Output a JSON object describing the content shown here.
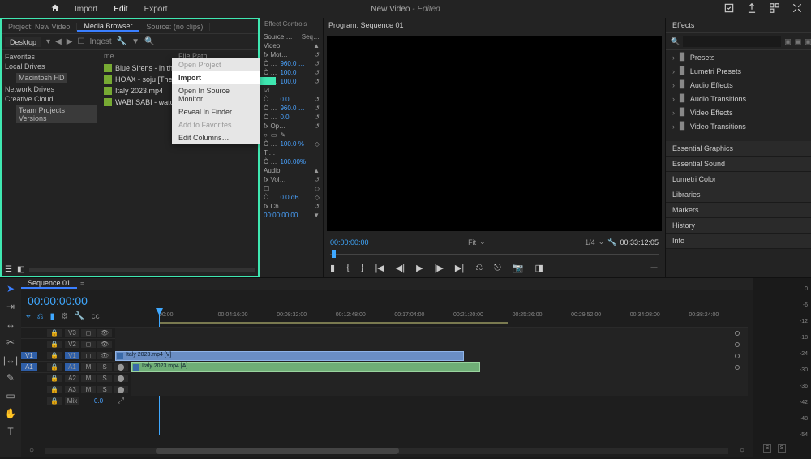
{
  "app_title": "New Video",
  "app_edited": "- Edited",
  "main_menu": {
    "import": "Import",
    "edit": "Edit",
    "export": "Export"
  },
  "project_panel": {
    "tabs": {
      "project": "Project: New Video",
      "media_browser": "Media Browser",
      "source": "Source: (no clips)"
    },
    "location_dropdown": "Desktop",
    "ingest_label": "Ingest",
    "tree": {
      "favorites": "Favorites",
      "local_drives": "Local Drives",
      "mac_hd": "Macintosh HD",
      "network_drives": "Network Drives",
      "creative_cloud": "Creative Cloud",
      "team_projects": "Team Projects Versions"
    },
    "list_headers": {
      "name": "me",
      "path": "File Path"
    },
    "files": [
      {
        "name": "Blue Sirens - in the win…"
      },
      {
        "name": "HOAX - soju [Thematic]"
      },
      {
        "name": "Italy 2023.mp4"
      },
      {
        "name": "WABI SABI - watch the …"
      }
    ]
  },
  "context_menu": {
    "open_project": "Open Project",
    "import": "Import",
    "open_source_monitor": "Open In Source Monitor",
    "reveal_finder": "Reveal In Finder",
    "add_favorites": "Add to Favorites",
    "edit_columns": "Edit Columns…"
  },
  "effect_controls": {
    "tab": "Effect Controls",
    "seq": "Seq…",
    "source_label": "Source …",
    "video": "Video",
    "motion": "fx  Mot…",
    "pos": "Ò  …",
    "pos_val": "960.0 …",
    "scale": "Ò  …",
    "scale_val": "100.0",
    "scalew": "Ò  …",
    "scalew_val": "100.0",
    "rot": "Ò  …",
    "rot_val": "0.0",
    "anchor": "Ò  …",
    "anchor_val": "960.0 …",
    "antiflicker": "Ò  …",
    "antiflicker_val": "0.0",
    "opacity": "fx  Op…",
    "op": "Ò  …",
    "op_val": "100.0  %",
    "time": "Ti…",
    "speed": "Ò  …",
    "speed_val": "100.00%",
    "audio": "Audio",
    "volume": "fx  Vol…",
    "level": "Ò  …",
    "level_val": "0.0  dB",
    "channel": "fx  Ch…",
    "tl_time": "00:00:00:00"
  },
  "program": {
    "tab": "Program: Sequence 01",
    "time": "00:00:00:00",
    "fit": "Fit",
    "scale": "1/4",
    "duration": "00:33:12:05"
  },
  "effects_panel": {
    "tab": "Effects",
    "search_placeholder": "",
    "folders": [
      "Presets",
      "Lumetri Presets",
      "Audio Effects",
      "Audio Transitions",
      "Video Effects",
      "Video Transitions"
    ],
    "sections": [
      "Essential Graphics",
      "Essential Sound",
      "Lumetri Color",
      "Libraries",
      "Markers",
      "History",
      "Info"
    ]
  },
  "timeline": {
    "tab": "Sequence 01",
    "time": "00:00:00:00",
    "ruler": [
      "00:00",
      "00:04:16:00",
      "00:08:32:00",
      "00:12:48:00",
      "00:17:04:00",
      "00:21:20:00",
      "00:25:36:00",
      "00:29:52:00",
      "00:34:08:00",
      "00:38:24:00"
    ],
    "tracks": {
      "v3": "V3",
      "v2": "V2",
      "v1": "V1",
      "a1": "A1",
      "a2": "A2",
      "a3": "A3",
      "mix": "Mix"
    },
    "v1_label_btn": "V1",
    "a1_label_btn": "A1",
    "mix_val": "0.0",
    "clip_v": "Italy 2023.mp4 [V]",
    "clip_a": "Italy 2023.mp4 [A]"
  },
  "meter": {
    "s": "S",
    "marks": [
      "0",
      "-6",
      "-12",
      "-18",
      "-24",
      "-30",
      "-36",
      "-42",
      "-48",
      "-54"
    ]
  }
}
